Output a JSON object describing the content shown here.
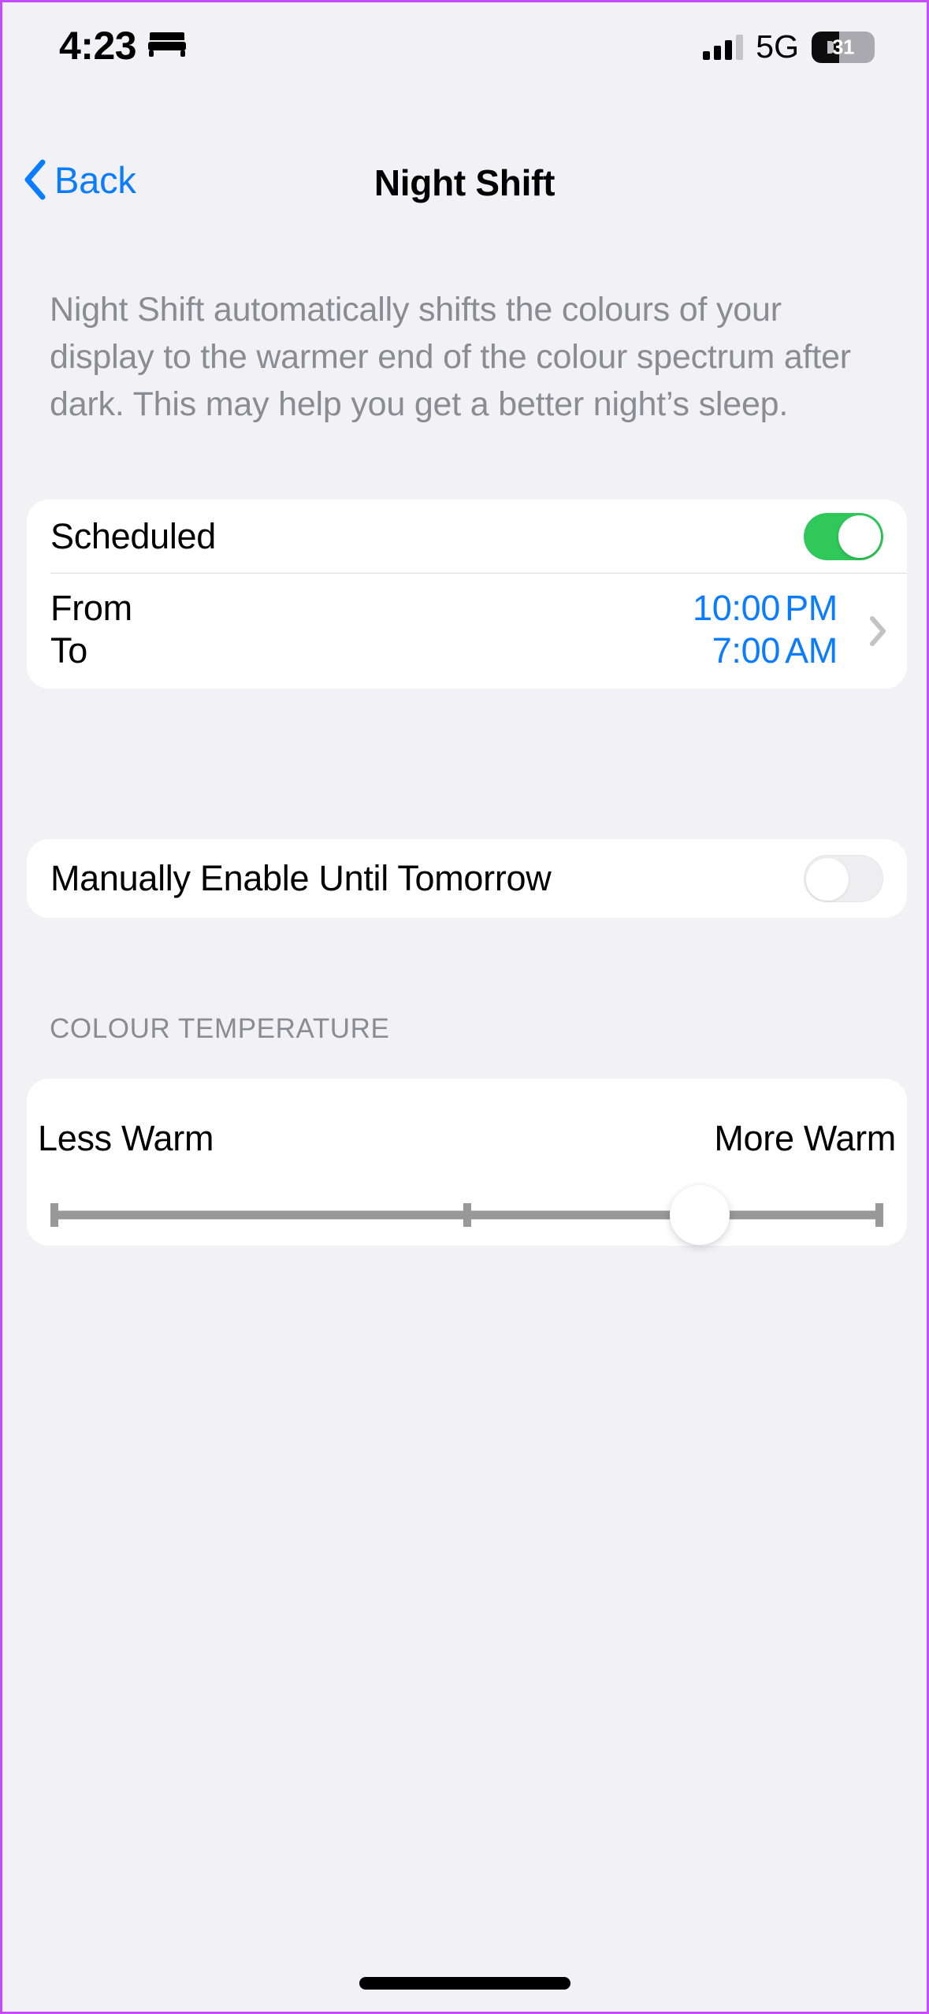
{
  "status_bar": {
    "time": "4:23",
    "focus_icon": "bed-icon",
    "signal_icon": "cellular-signal-icon",
    "signal_bars_filled": 3,
    "signal_bars_total": 4,
    "network": "5G",
    "battery_percent": "31",
    "battery_level": 31
  },
  "nav": {
    "back_label": "Back",
    "back_icon": "chevron-left-icon",
    "title": "Night Shift"
  },
  "description": "Night Shift automatically shifts the colours of your display to the warmer end of the colour spectrum after dark. This may help you get a better night’s sleep.",
  "scheduled_section": {
    "scheduled_label": "Scheduled",
    "scheduled_toggle_state": "on",
    "from_label": "From",
    "from_value_time": "10:00",
    "from_value_ampm": "PM",
    "to_label": "To",
    "to_value_time": "7:00",
    "to_value_ampm": "AM",
    "disclosure_icon": "chevron-right-icon"
  },
  "manual_section": {
    "label": "Manually Enable Until Tomorrow",
    "toggle_state": "off"
  },
  "colour_temperature": {
    "header": "COLOUR TEMPERATURE",
    "less_warm_label": "Less Warm",
    "more_warm_label": "More Warm",
    "slider_value_percent": 78
  },
  "home_indicator": "home-indicator",
  "colors": {
    "page_background": "#f2f1f6",
    "card_background": "#ffffff",
    "accent_blue": "#0a7cff",
    "toggle_on_green": "#30c85a",
    "secondary_text": "#8b8b92",
    "slider_track": "#989898",
    "frame_border": "#c44dff"
  }
}
